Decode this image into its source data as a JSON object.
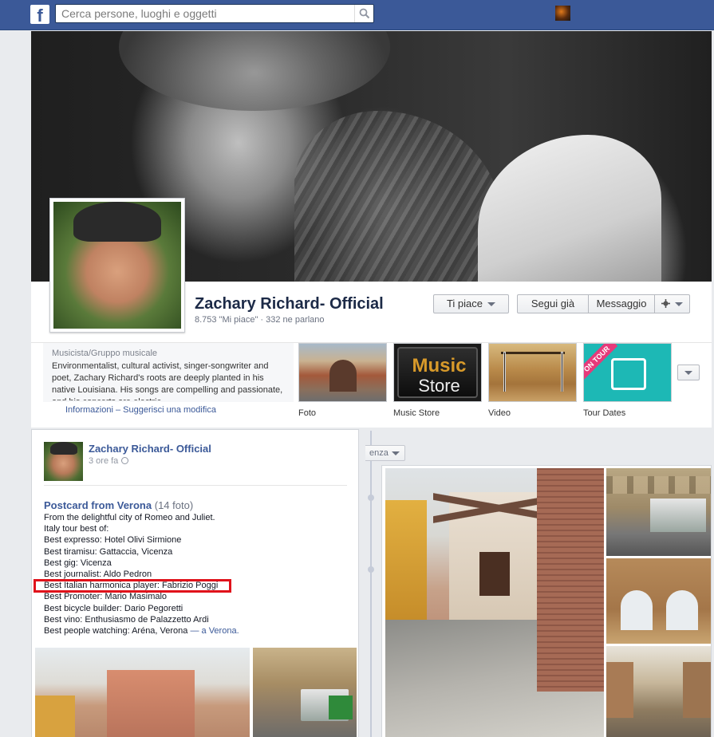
{
  "topbar": {
    "logo": "f",
    "search_placeholder": "Cerca persone, luoghi e oggetti",
    "search_icon": "search-icon"
  },
  "page": {
    "name": "Zachary Richard- Official",
    "likes_line": "8.753 \"Mi piace\" · 332 ne parlano"
  },
  "actions": {
    "like_label": "Ti piace",
    "follow_label": "Segui già",
    "message_label": "Messaggio",
    "gear_icon": "gear-icon"
  },
  "about": {
    "category": "Musicista/Gruppo musicale",
    "text": "Environmentalist, cultural activist, singer-songwriter and poet, Zachary Richard's roots are deeply planted in his native Louisiana. His songs are compelling and passionate, and his concerts are electric.",
    "info_link": "Informazioni",
    "separator": "–",
    "suggest_link": "Suggerisci una modifica"
  },
  "apps": [
    {
      "label": "Foto"
    },
    {
      "label": "Music Store",
      "tile_line1": "Music",
      "tile_line2": "Store"
    },
    {
      "label": "Video"
    },
    {
      "label": "Tour Dates",
      "ribbon": "ON TOUR"
    }
  ],
  "timeline": {
    "filter_label": "enza"
  },
  "post": {
    "author": "Zachary Richard- Official",
    "time": "3 ore fa",
    "album_title": "Postcard from Verona",
    "album_count": "(14 foto)",
    "lines": [
      "From the delightful city of Romeo and Juliet.",
      "Italy tour best of:",
      "Best expresso: Hotel Olivi Sirmione",
      "Best tiramisu: Gattaccia, Vicenza",
      "Best gig: Vicenza",
      "Best journalist: Aldo Pedron",
      "Best Italian harmonica player: Fabrizio Poggi",
      "Best Promoter: Mario Masimalo",
      "Best bicycle builder: Dario Pegoretti",
      "Best vino: Enthusiasmo de Palazzetto Ardi"
    ],
    "last_line_text": "Best people watching: Aréna, Verona ",
    "last_line_link": "— a Verona."
  },
  "colors": {
    "brand": "#3b5998",
    "highlight": "#e0121b"
  }
}
